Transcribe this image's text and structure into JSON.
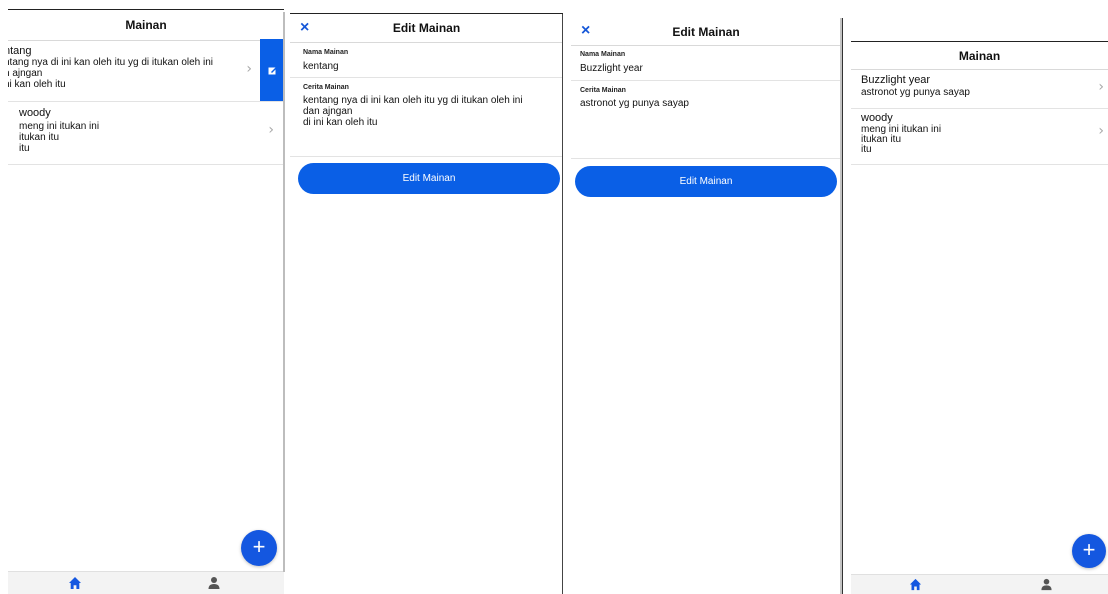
{
  "colors": {
    "accent": "#0a5fe6",
    "fab": "#1457e0",
    "close": "#1557d8"
  },
  "list_screen_1": {
    "title": "Mainan",
    "items": [
      {
        "name": "ntang",
        "lines": [
          "ntang nya di ini kan oleh itu yg di itukan oleh ini",
          "n ajngan",
          "ni kan oleh itu"
        ]
      },
      {
        "name": "woody",
        "lines": [
          "meng ini itukan ini",
          "itukan itu",
          "itu"
        ]
      }
    ],
    "swipe_action_icon": "edit-icon",
    "fab_label": "+"
  },
  "edit_screen_1": {
    "title": "Edit Mainan",
    "close_label": "×",
    "name_label": "Nama Mainan",
    "name_value": "kentang",
    "story_label": "Cerita Mainan",
    "story_value": "kentang nya di ini kan oleh itu yg di itukan oleh ini\ndan ajngan\ndi ini kan oleh itu",
    "submit_label": "Edit Mainan"
  },
  "edit_screen_2": {
    "title": "Edit Mainan",
    "close_label": "×",
    "name_label": "Nama Mainan",
    "name_value": "Buzzlight year",
    "story_label": "Cerita Mainan",
    "story_value": "astronot yg punya sayap",
    "submit_label": "Edit Mainan"
  },
  "list_screen_2": {
    "title": "Mainan",
    "items": [
      {
        "name": "Buzzlight year",
        "lines": [
          "astronot yg punya sayap"
        ]
      },
      {
        "name": "woody",
        "lines": [
          "meng ini itukan ini",
          "itukan itu",
          "itu"
        ]
      }
    ],
    "fab_label": "+"
  },
  "tabbar": {
    "tabs": [
      "home-icon",
      "person-icon"
    ]
  }
}
